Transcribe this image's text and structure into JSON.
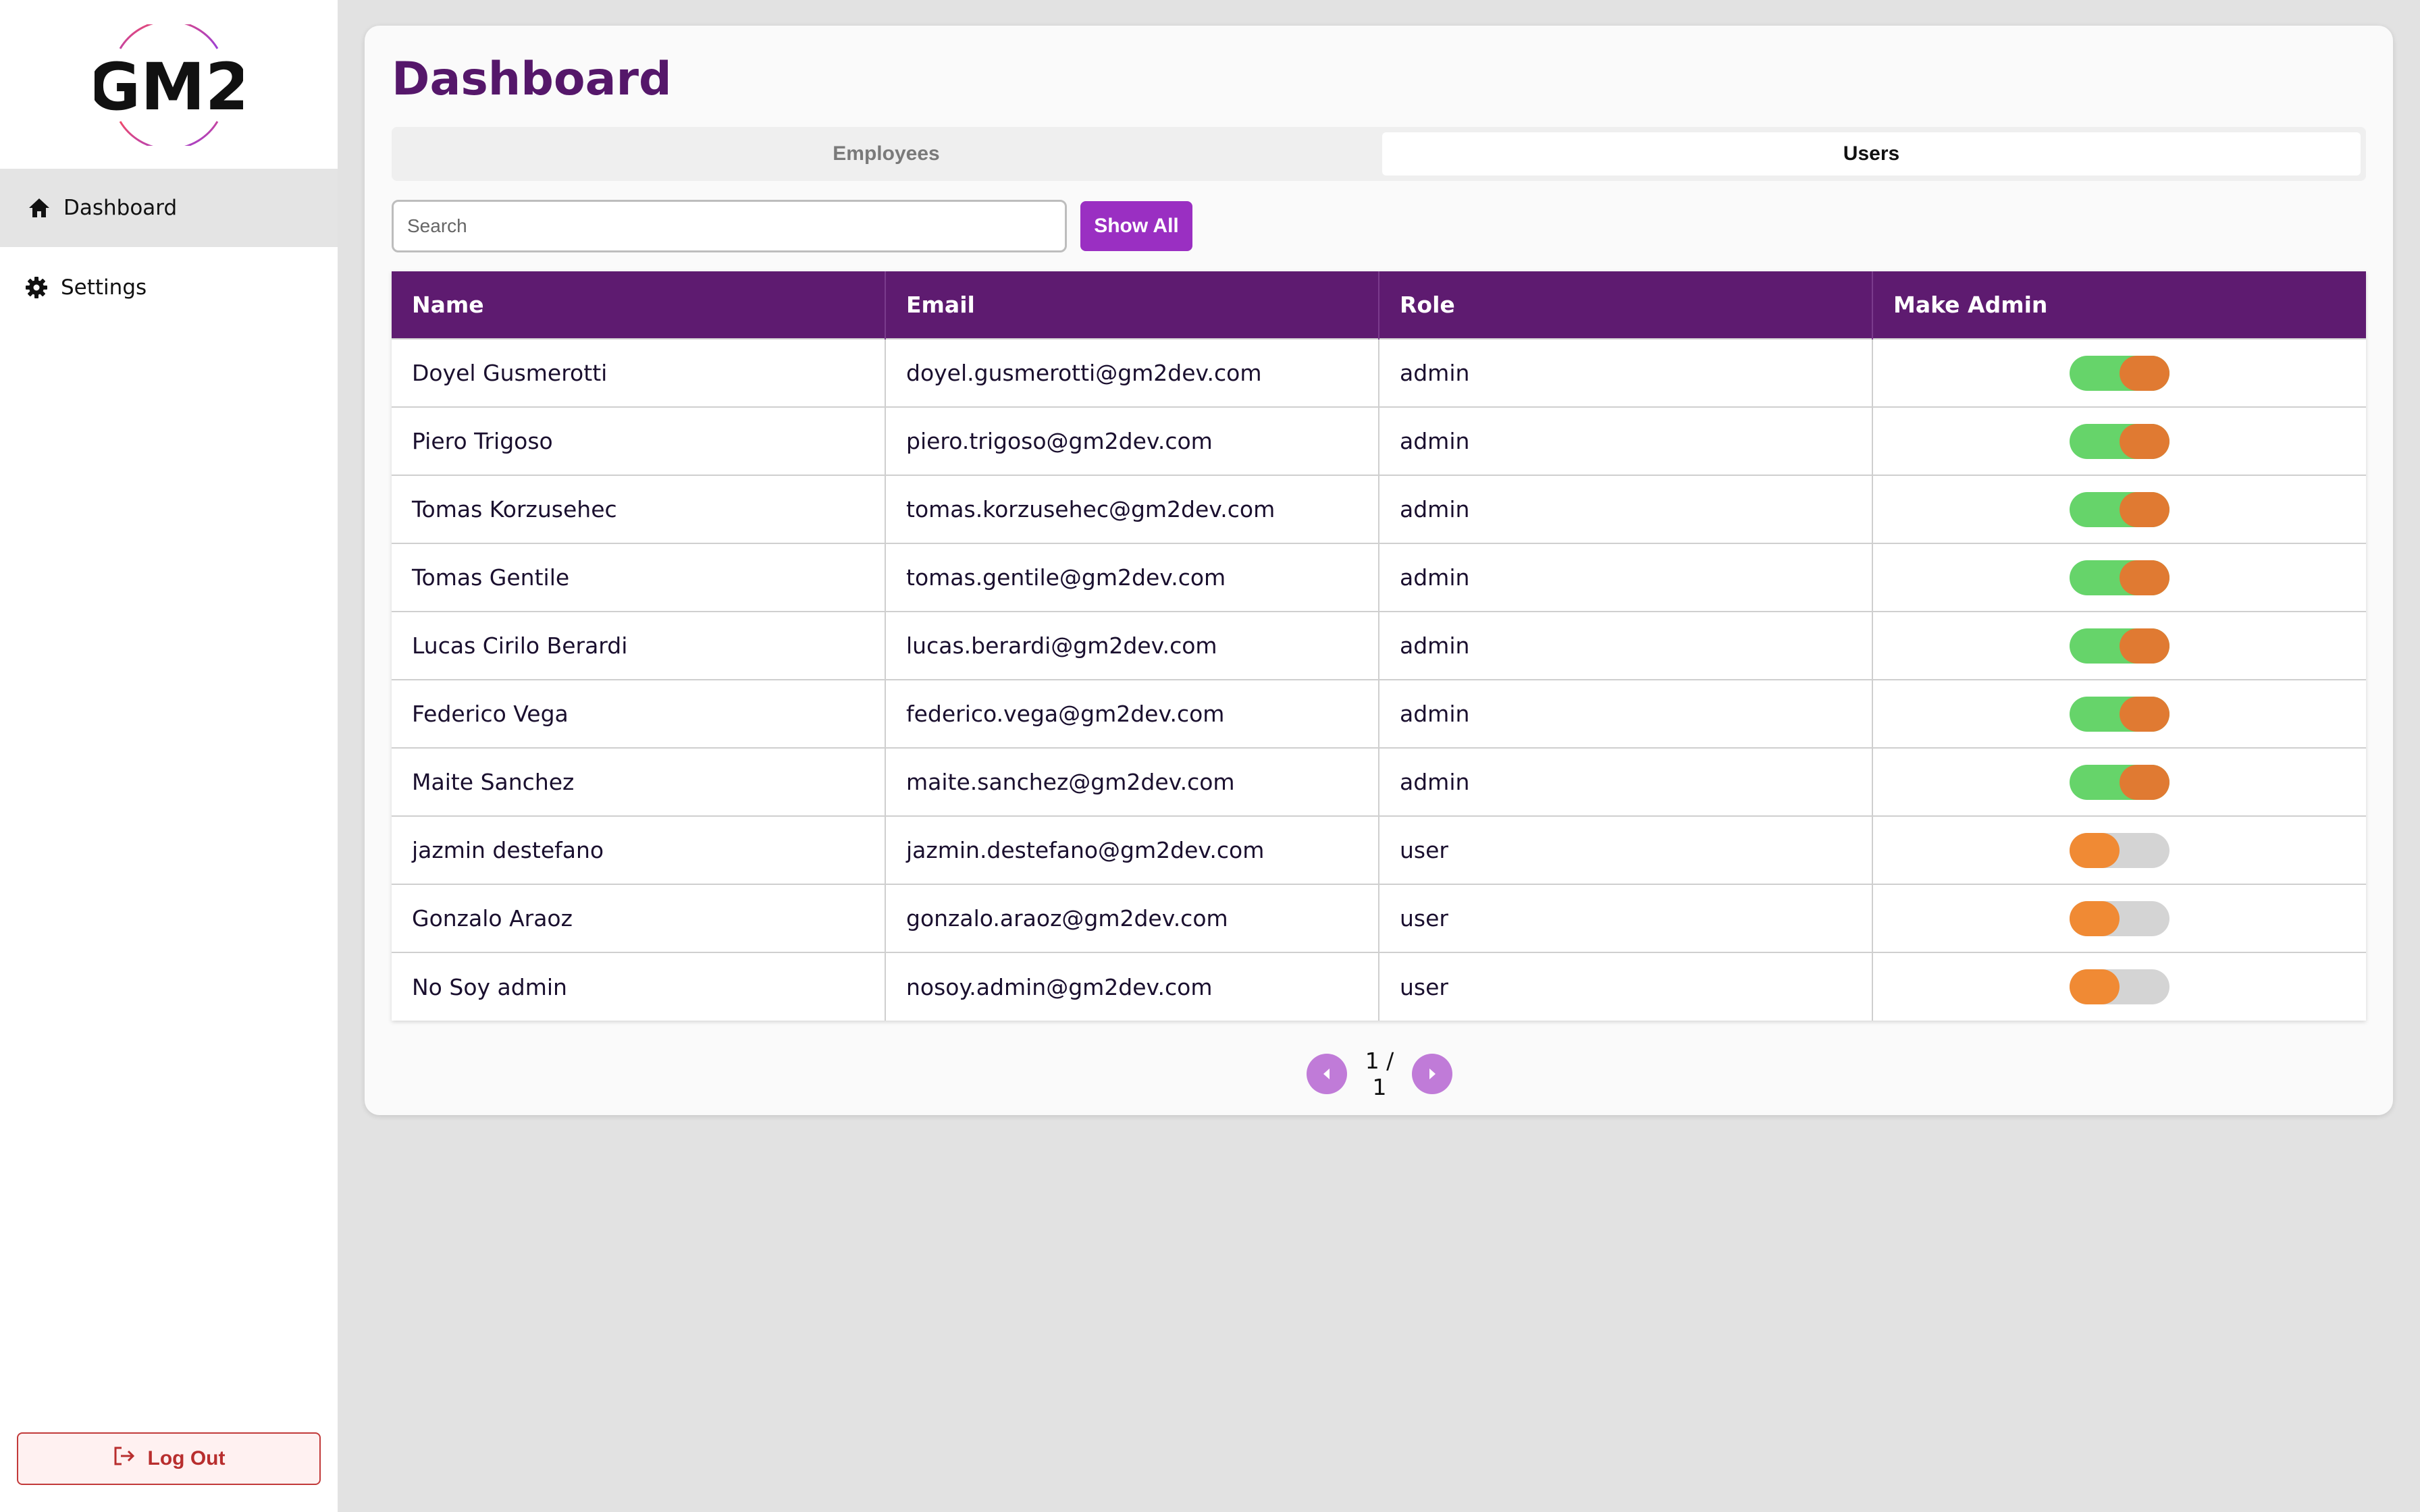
{
  "sidebar": {
    "logo_text": "GM2",
    "items": [
      {
        "label": "Dashboard",
        "icon": "home-icon",
        "active": true
      },
      {
        "label": "Settings",
        "icon": "gear-icon",
        "active": false
      }
    ],
    "logout_label": "Log Out"
  },
  "main": {
    "title": "Dashboard",
    "tabs": [
      {
        "label": "Employees",
        "active": false
      },
      {
        "label": "Users",
        "active": true
      }
    ],
    "search": {
      "placeholder": "Search",
      "value": ""
    },
    "show_all_label": "Show All",
    "table": {
      "headers": [
        "Name",
        "Email",
        "Role",
        "Make Admin"
      ],
      "rows": [
        {
          "name": "Doyel Gusmerotti",
          "email": "doyel.gusmerotti@gm2dev.com",
          "role": "admin",
          "admin": true
        },
        {
          "name": "Piero Trigoso",
          "email": "piero.trigoso@gm2dev.com",
          "role": "admin",
          "admin": true
        },
        {
          "name": "Tomas Korzusehec",
          "email": "tomas.korzusehec@gm2dev.com",
          "role": "admin",
          "admin": true
        },
        {
          "name": "Tomas Gentile",
          "email": "tomas.gentile@gm2dev.com",
          "role": "admin",
          "admin": true
        },
        {
          "name": "Lucas Cirilo Berardi",
          "email": "lucas.berardi@gm2dev.com",
          "role": "admin",
          "admin": true
        },
        {
          "name": "Federico Vega",
          "email": "federico.vega@gm2dev.com",
          "role": "admin",
          "admin": true
        },
        {
          "name": "Maite Sanchez",
          "email": "maite.sanchez@gm2dev.com",
          "role": "admin",
          "admin": true
        },
        {
          "name": "jazmin destefano",
          "email": "jazmin.destefano@gm2dev.com",
          "role": "user",
          "admin": false
        },
        {
          "name": "Gonzalo Araoz",
          "email": "gonzalo.araoz@gm2dev.com",
          "role": "user",
          "admin": false
        },
        {
          "name": "No Soy admin",
          "email": "nosoy.admin@gm2dev.com",
          "role": "user",
          "admin": false
        }
      ]
    },
    "pagination": {
      "text": "1 / 1"
    }
  },
  "colors": {
    "brand": "#5e1b70",
    "accent": "#9a2fc2",
    "toggle_on": "#66d46a",
    "toggle_knob": "#e07a32",
    "logout": "#b82e2e"
  }
}
